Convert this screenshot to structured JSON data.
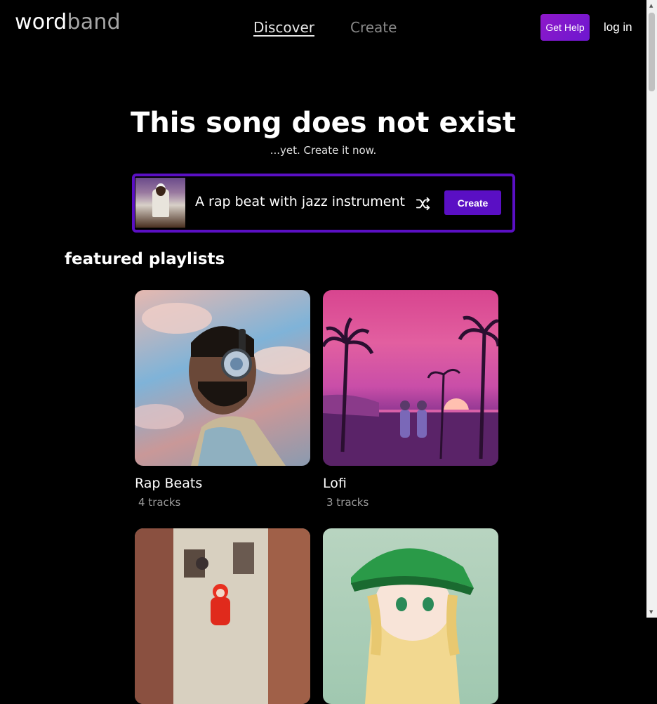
{
  "header": {
    "logo_word": "word",
    "logo_band": "band",
    "nav": {
      "discover": "Discover",
      "create": "Create"
    },
    "help_label": "Get Help",
    "login_label": "log in"
  },
  "hero": {
    "title": "This song does not exist",
    "subtitle": "...yet. Create it now."
  },
  "prompt": {
    "value": "A rap beat with jazz instruments",
    "create_label": "Create"
  },
  "featured": {
    "title": "featured playlists",
    "playlists": [
      {
        "name": "Rap Beats",
        "tracks": "4 tracks"
      },
      {
        "name": "Lofi",
        "tracks": "3 tracks"
      },
      {
        "name": "",
        "tracks": ""
      },
      {
        "name": "",
        "tracks": ""
      }
    ]
  },
  "icons": [
    "shuffle-icon"
  ],
  "colors": {
    "accent": "#5a0fc4",
    "help_gradient_start": "#8f18c9",
    "background": "#000000"
  }
}
